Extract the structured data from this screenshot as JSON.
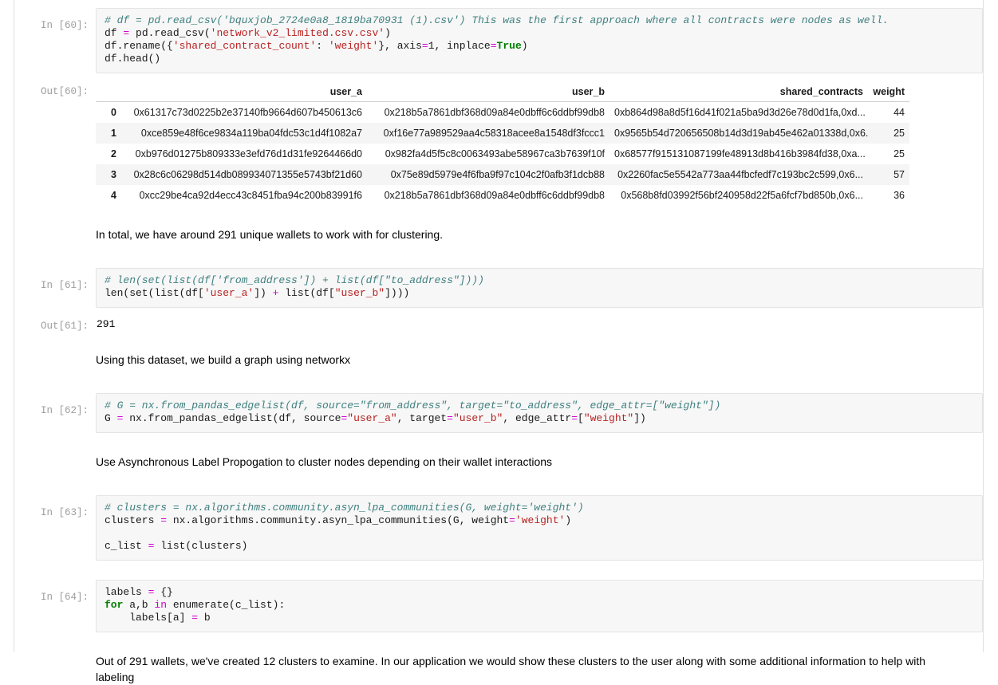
{
  "cells": [
    {
      "prompt_in": "In [60]:",
      "prompt_out": "Out[60]:",
      "code_lines": [
        "# df = pd.read_csv('bquxjob_2724e0a8_1819ba70931 (1).csv') This was the first approach where all contracts were nodes as well.",
        "df = pd.read_csv('network_v2_limited.csv.csv')",
        "df.rename({'shared_contract_count': 'weight'}, axis=1, inplace=True)",
        "df.head()"
      ]
    },
    {
      "prompt_in": "In [61]:",
      "prompt_out": "Out[61]:",
      "code_lines": [
        "# len(set(list(df['from_address']) + list(df[\"to_address\"])))",
        "len(set(list(df['user_a']) + list(df[\"user_b\"])))"
      ],
      "output_text": "291"
    },
    {
      "prompt_in": "In [62]:",
      "code_lines": [
        "# G = nx.from_pandas_edgelist(df, source=\"from_address\", target=\"to_address\", edge_attr=[\"weight\"])",
        "G = nx.from_pandas_edgelist(df, source=\"user_a\", target=\"user_b\", edge_attr=[\"weight\"])"
      ]
    },
    {
      "prompt_in": "In [63]:",
      "code_lines": [
        "# clusters = nx.algorithms.community.asyn_lpa_communities(G, weight='weight')",
        "clusters = nx.algorithms.community.asyn_lpa_communities(G, weight='weight')",
        "",
        "c_list = list(clusters)"
      ]
    },
    {
      "prompt_in": "In [64]:",
      "code_lines": [
        "labels = {}",
        "for a,b in enumerate(c_list):",
        "    labels[a] = b"
      ]
    }
  ],
  "dataframe": {
    "columns": [
      "user_a",
      "user_b",
      "shared_contracts",
      "weight"
    ],
    "index": [
      "0",
      "1",
      "2",
      "3",
      "4"
    ],
    "rows": [
      {
        "index": "0",
        "user_a": "0x61317c73d0225b2e37140fb9664d607b450613c6",
        "user_b": "0x218b5a7861dbf368d09a84e0dbff6c6ddbf99db8",
        "shared_contracts": "0xb864d98a8d5f16d41f021a5ba9d3d26e78d0d1fa,0xd...",
        "weight": "44"
      },
      {
        "index": "1",
        "user_a": "0xce859e48f6ce9834a119ba04fdc53c1d4f1082a7",
        "user_b": "0xf16e77a989529aa4c58318acee8a1548df3fccc1",
        "shared_contracts": "0x9565b54d720656508b14d3d19ab45e462a01338d,0x6...",
        "weight": "25"
      },
      {
        "index": "2",
        "user_a": "0xb976d01275b809333e3efd76d1d31fe9264466d0",
        "user_b": "0x982fa4d5f5c8c0063493abe58967ca3b7639f10f",
        "shared_contracts": "0x68577f915131087199fe48913d8b416b3984fd38,0xa...",
        "weight": "25"
      },
      {
        "index": "3",
        "user_a": "0x28c6c06298d514db089934071355e5743bf21d60",
        "user_b": "0x75e89d5979e4f6fba9f97c104c2f0afb3f1dcb88",
        "shared_contracts": "0x2260fac5e5542a773aa44fbcfedf7c193bc2c599,0x6...",
        "weight": "57"
      },
      {
        "index": "4",
        "user_a": "0xcc29be4ca92d4ecc43c8451fba94c200b83991f6",
        "user_b": "0x218b5a7861dbf368d09a84e0dbff6c6ddbf99db8",
        "shared_contracts": "0x568b8fd03992f56bf240958d22f5a6fcf7bd850b,0x6...",
        "weight": "36"
      }
    ]
  },
  "markdown": {
    "md1": "In total, we have around 291 unique wallets to work with for clustering.",
    "md2": "Using this dataset, we build a graph using networkx",
    "md3": "Use Asynchronous Label Propogation to cluster nodes depending on their wallet interactions",
    "md4": "Out of 291 wallets, we've created 12 clusters to examine. In our application we would show these clusters to the user along with some additional information to help with labeling"
  }
}
